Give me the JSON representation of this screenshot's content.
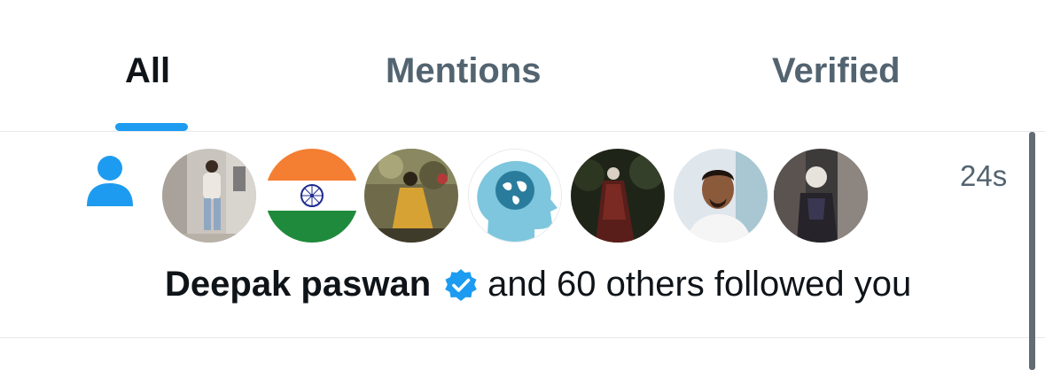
{
  "tabs": {
    "all": "All",
    "mentions": "Mentions",
    "verified": "Verified"
  },
  "notification": {
    "icon": "person-icon",
    "timestamp": "24s",
    "user_name": "Deepak paswan",
    "verified": true,
    "message": "and 60 others followed you",
    "avatars": [
      {
        "name": "avatar-1"
      },
      {
        "name": "avatar-2-india-flag"
      },
      {
        "name": "avatar-3"
      },
      {
        "name": "avatar-4-world-head"
      },
      {
        "name": "avatar-5"
      },
      {
        "name": "avatar-6"
      },
      {
        "name": "avatar-7"
      }
    ]
  },
  "colors": {
    "accent": "#1d9bf0",
    "text_primary": "#0f1419",
    "text_secondary": "#536471",
    "divider": "#e6e9ec"
  }
}
